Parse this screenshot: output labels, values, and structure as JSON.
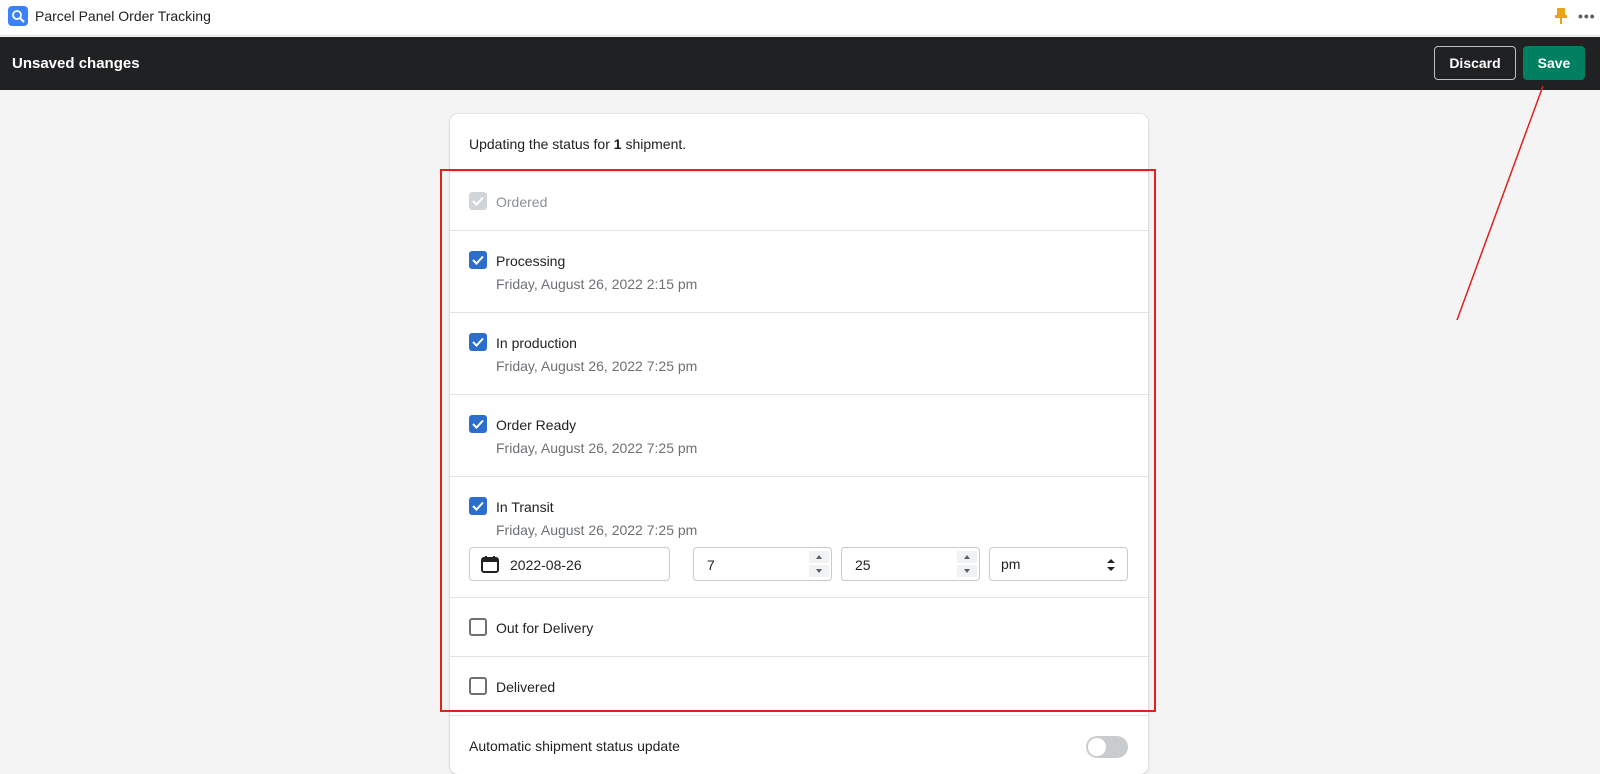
{
  "app": {
    "title": "Parcel Panel Order Tracking",
    "more_label": "•••"
  },
  "save_bar": {
    "title": "Unsaved changes",
    "discard_label": "Discard",
    "save_label": "Save"
  },
  "intro": {
    "prefix": "Updating the status for ",
    "count": "1",
    "suffix": " shipment."
  },
  "statuses": [
    {
      "label": "Ordered",
      "state": "disabled-checked",
      "date": ""
    },
    {
      "label": "Processing",
      "state": "checked",
      "date": "Friday, August 26, 2022 2:15 pm"
    },
    {
      "label": "In production",
      "state": "checked",
      "date": "Friday, August 26, 2022 7:25 pm"
    },
    {
      "label": "Order Ready",
      "state": "checked",
      "date": "Friday, August 26, 2022 7:25 pm"
    },
    {
      "label": "In Transit",
      "state": "checked",
      "date": "Friday, August 26, 2022 7:25 pm"
    },
    {
      "label": "Out for Delivery",
      "state": "unchecked",
      "date": ""
    },
    {
      "label": "Delivered",
      "state": "unchecked",
      "date": ""
    }
  ],
  "transit_editor": {
    "date": "2022-08-26",
    "hour": "7",
    "minute": "25",
    "period": "pm"
  },
  "auto_update": {
    "label": "Automatic shipment status update",
    "enabled": false
  },
  "colors": {
    "accent": "#2c6ecb",
    "save": "#008060",
    "annotation": "#e0221e",
    "bar": "#202123"
  }
}
